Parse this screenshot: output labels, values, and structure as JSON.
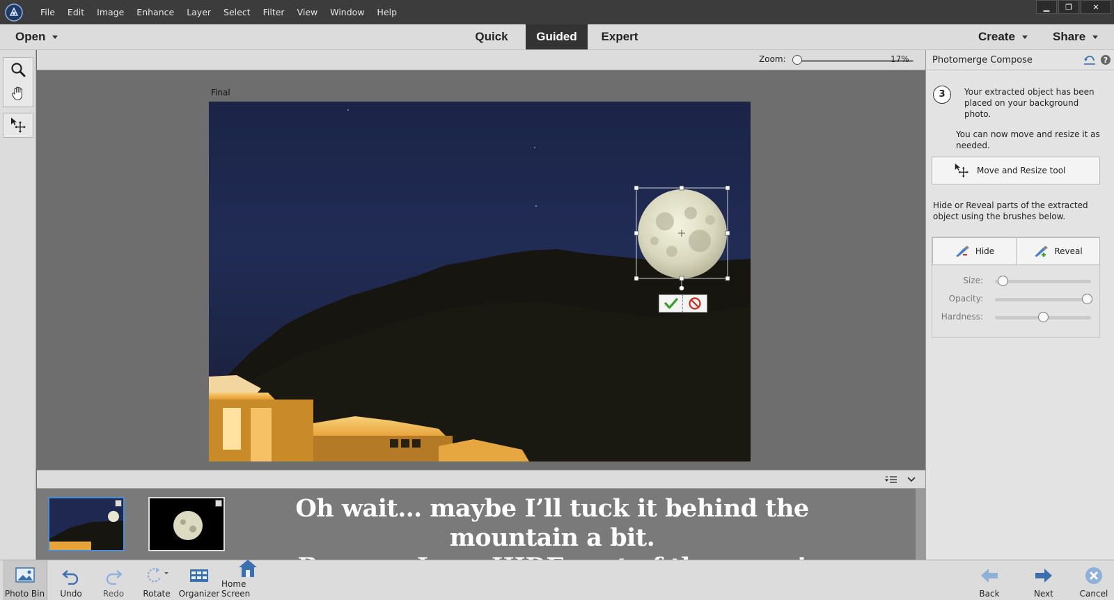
{
  "menu": {
    "items": [
      "File",
      "Edit",
      "Image",
      "Enhance",
      "Layer",
      "Select",
      "Filter",
      "View",
      "Window",
      "Help"
    ]
  },
  "window": {
    "minimize": "▁",
    "restore": "❐",
    "close": "✕"
  },
  "modebar": {
    "open_label": "Open",
    "quick": "Quick",
    "guided": "Guided",
    "expert": "Expert",
    "create": "Create",
    "share": "Share"
  },
  "zoom": {
    "label": "Zoom:",
    "value": "17%",
    "level_percent": 17
  },
  "canvas": {
    "title": "Final"
  },
  "panel": {
    "title": "Photomerge Compose",
    "step_number": "3",
    "step_text": "Your extracted object has been placed on your background photo.",
    "step_text2": "You can now move and resize it as needed.",
    "move_tool_label": "Move and Resize tool",
    "hide_reveal_text": "Hide or Reveal parts of the extracted object using the brushes below.",
    "hide_label": "Hide",
    "reveal_label": "Reveal",
    "size_label": "Size:",
    "opacity_label": "Opacity:",
    "hardness_label": "Hardness:",
    "size_value": 0.05,
    "opacity_value": 1.0,
    "hardness_value": 0.5
  },
  "bin": {
    "caption_line1": "Oh wait…  maybe I’ll tuck it behind the mountain a bit.",
    "caption_line2": "Because I can HIDE part of the moon!"
  },
  "bottom": {
    "photo_bin": "Photo Bin",
    "undo": "Undo",
    "redo": "Redo",
    "rotate": "Rotate",
    "organizer": "Organizer",
    "home_screen": "Home Screen",
    "back": "Back",
    "next": "Next",
    "cancel": "Cancel"
  },
  "colors": {
    "accent": "#4a8ed8",
    "menubar": "#3c3c3c",
    "active_mode": "#333333",
    "commit_green": "#3a9a2a",
    "cancel_red": "#c0392b"
  }
}
